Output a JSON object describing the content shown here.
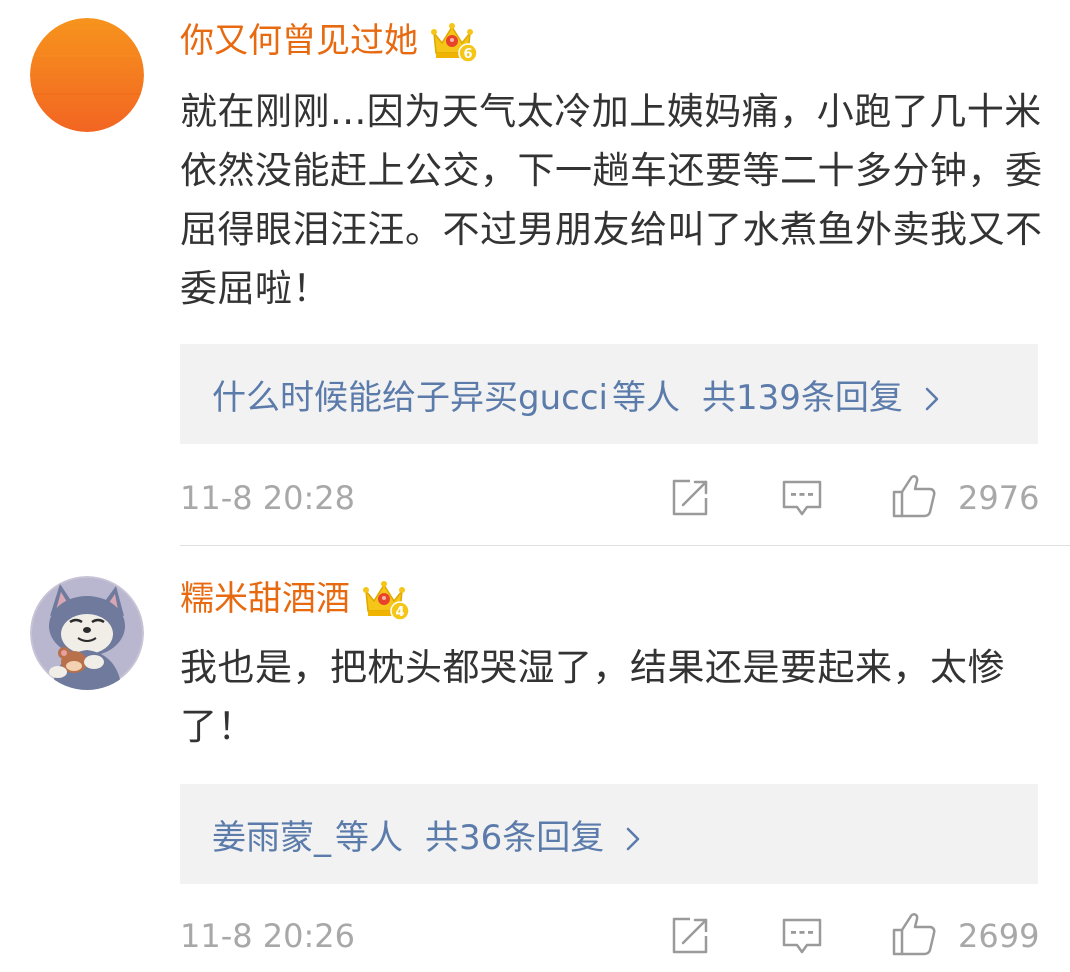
{
  "colors": {
    "username": "#e86a10",
    "reply_link": "#5b7bab",
    "meta_gray": "#a8a8a8",
    "reply_bg": "#f2f2f2",
    "text": "#333333"
  },
  "comments": [
    {
      "username": "你又何曾见过她",
      "vip_level": "6",
      "avatar": "orange-circle-avatar",
      "text": "就在刚刚...因为天气太冷加上姨妈痛，小跑了几十米依然没能赶上公交，下一趟车还要等二十多分钟，委屈得眼泪汪汪。不过男朋友给叫了水煮鱼外卖我又不委屈啦！",
      "replies": {
        "users": "什么时候能给子异买gucci",
        "suffix": "等人",
        "count": "共139条回复"
      },
      "timestamp": "11-8 20:28",
      "likes": "2976"
    },
    {
      "username": "糯米甜酒酒",
      "vip_level": "4",
      "avatar": "cartoon-cat-avatar",
      "text": "我也是，把枕头都哭湿了，结果还是要起来，太惨了！",
      "replies": {
        "users": "姜雨蒙_",
        "suffix": "等人",
        "count": "共36条回复"
      },
      "timestamp": "11-8 20:26",
      "likes": "2699"
    }
  ],
  "icons": {
    "vip": "crown-icon",
    "share": "share-icon",
    "comment": "comment-icon",
    "like": "thumbs-up-icon",
    "chevron": "chevron-right-icon"
  }
}
